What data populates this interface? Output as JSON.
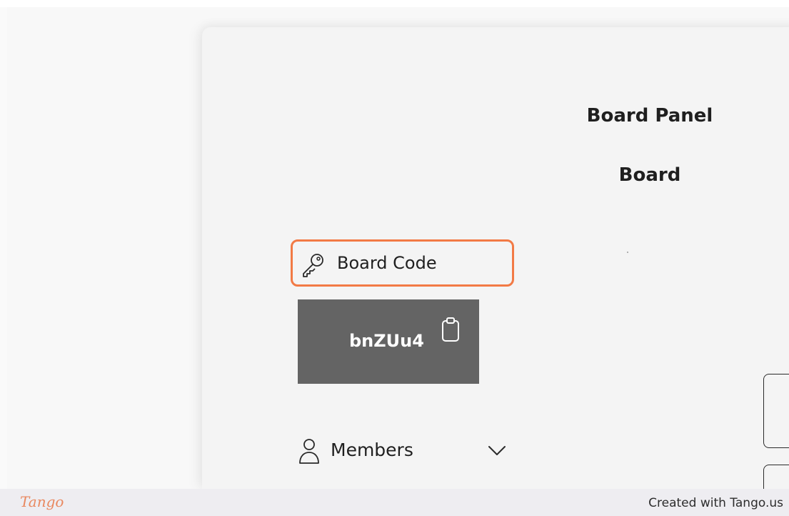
{
  "header": {
    "panel_title": "Board Panel",
    "board_title": "Board"
  },
  "sidebar": {
    "board_code_label": "Board Code",
    "board_code_value": "bnZUu4",
    "members_label": "Members"
  },
  "icons": {
    "key": "key-icon",
    "clipboard": "clipboard-icon",
    "person": "person-icon",
    "chevron": "chevron-down-icon"
  },
  "footer": {
    "logo_text": "Tango",
    "credit": "Created with Tango.us"
  },
  "colors": {
    "highlight": "#f27a45",
    "code_box": "#646464",
    "logo": "#e9885f",
    "footer_bg": "#eeedf1"
  }
}
